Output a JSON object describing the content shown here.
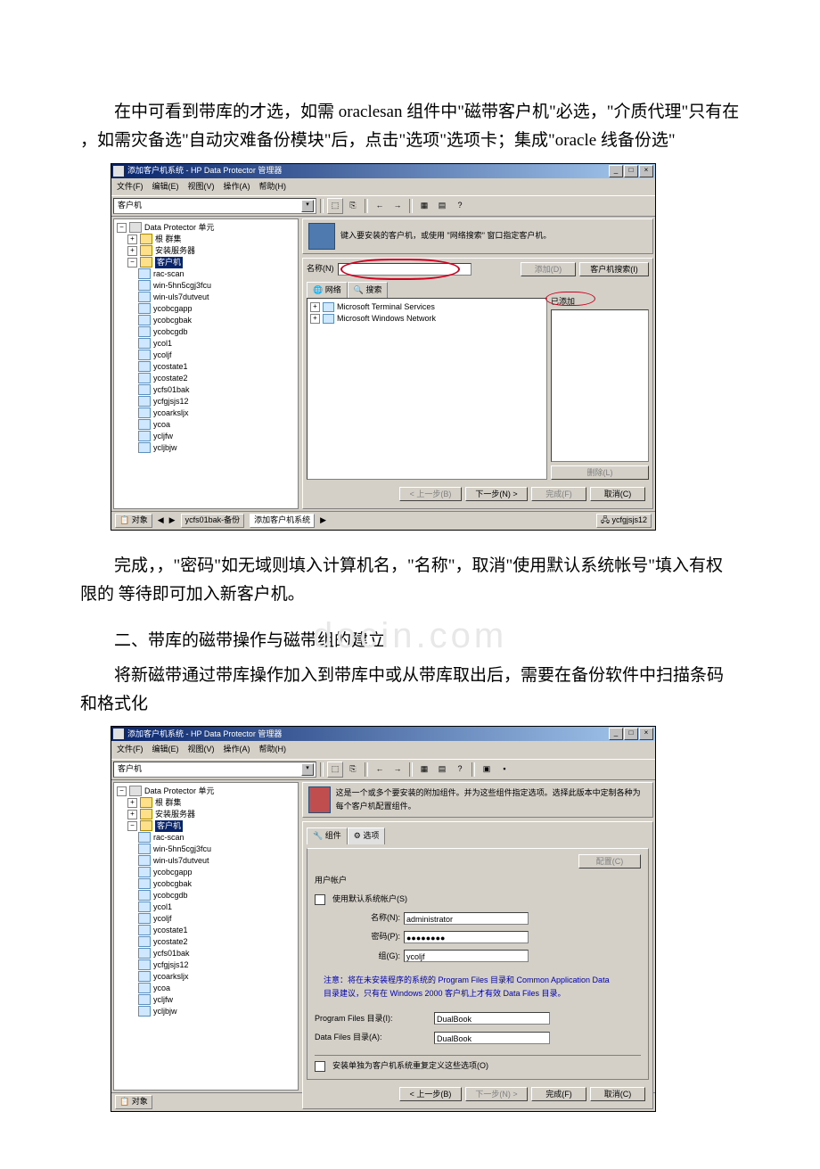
{
  "paragraphs": {
    "p1": "在中可看到带库的才选，如需 oraclesan 组件中\"磁带客户机\"必选，\"介质代理\"只有在 ，如需灾备选\"自动灾难备份模块\"后，点击\"选项\"选项卡；集成\"oracle 线备份选\"",
    "p2": "完成，，\"密码\"如无域则填入计算机名，\"名称\"，取消\"使用默认系统帐号\"填入有权限的 等待即可加入新客户机。",
    "section2": "二、带库的磁带操作与磁带组的建立",
    "p3": "将新磁带通过带库操作加入到带库中或从带库取出后，需要在备份软件中扫描条码和格式化"
  },
  "watermark": "docin.com",
  "app": {
    "title": "添加客户机系统 - HP Data Protector 管理器",
    "menus": [
      "文件(F)",
      "编辑(E)",
      "视图(V)",
      "操作(A)",
      "帮助(H)"
    ],
    "context_dd": "客户机",
    "tree": {
      "root": "Data Protector 单元",
      "group1": "根 群集",
      "group2": "安装服务器",
      "group3": "客户机",
      "clients": [
        "rac-scan",
        "win-5hn5cgj3fcu",
        "win-uls7dutveut",
        "ycobcgapp",
        "ycobcgbak",
        "ycobcgdb",
        "ycol1",
        "ycoljf",
        "ycostate1",
        "ycostate2",
        "ycfs01bak",
        "ycfgjsjs12",
        "ycoarksljx",
        "ycoa",
        "ycljfw",
        "ycljbjw"
      ]
    }
  },
  "screenshot1": {
    "header_text": "键入要安装的客户机，或使用 \"网络搜索\" 窗口指定客户机。",
    "name_label": "名称(N)",
    "add_btn": "添加(D)",
    "client_search_btn": "客户机搜索(I)",
    "added_label": "已添加",
    "tab_network": "网络",
    "tab_search": "搜索",
    "net1": "Microsoft Terminal Services",
    "net2": "Microsoft Windows Network",
    "delete_btn": "删除(L)",
    "footer": {
      "prev": "< 上一步(B)",
      "next": "下一步(N) >",
      "finish": "完成(F)",
      "cancel": "取消(C)"
    },
    "status1": "对象",
    "status_tab1": "ycfs01bak-备份",
    "status_tab2": "添加客户机系统",
    "status_right": "ycfgjsjs12"
  },
  "screenshot2": {
    "header_text": "这是一个或多个要安装的附加组件。并为这些组件指定选项。选择此版本中定制各种为每个客户机配置组件。",
    "tab_components": "组件",
    "tab_options": "选项",
    "configure_btn": "配置(C)",
    "account_group": "用户帐户",
    "use_default_chk": "使用默认系统帐户(S)",
    "name_label": "名称(N):",
    "name_value": "administrator",
    "pwd_label": "密码(P):",
    "pwd_value": "●●●●●●●●",
    "group_label": "组(G):",
    "group_value": "ycoljf",
    "note": "注意：将在未安装程序的系统的 Program Files 目录和 Common Application Data 目录建议，只有在 Windows 2000 客户机上才有效 Data Files 目录。",
    "pf_label": "Program Files 目录(I):",
    "pf_value": "DualBook",
    "df_label": "Data Files 目录(A):",
    "df_value": "DualBook",
    "bottom_chk": "安装单独为客户机系统重复定义这些选项(O)",
    "footer": {
      "prev": "< 上一步(B)",
      "next": "下一步(N) >",
      "finish": "完成(F)",
      "cancel": "取消(C)"
    },
    "status1": "对象"
  }
}
